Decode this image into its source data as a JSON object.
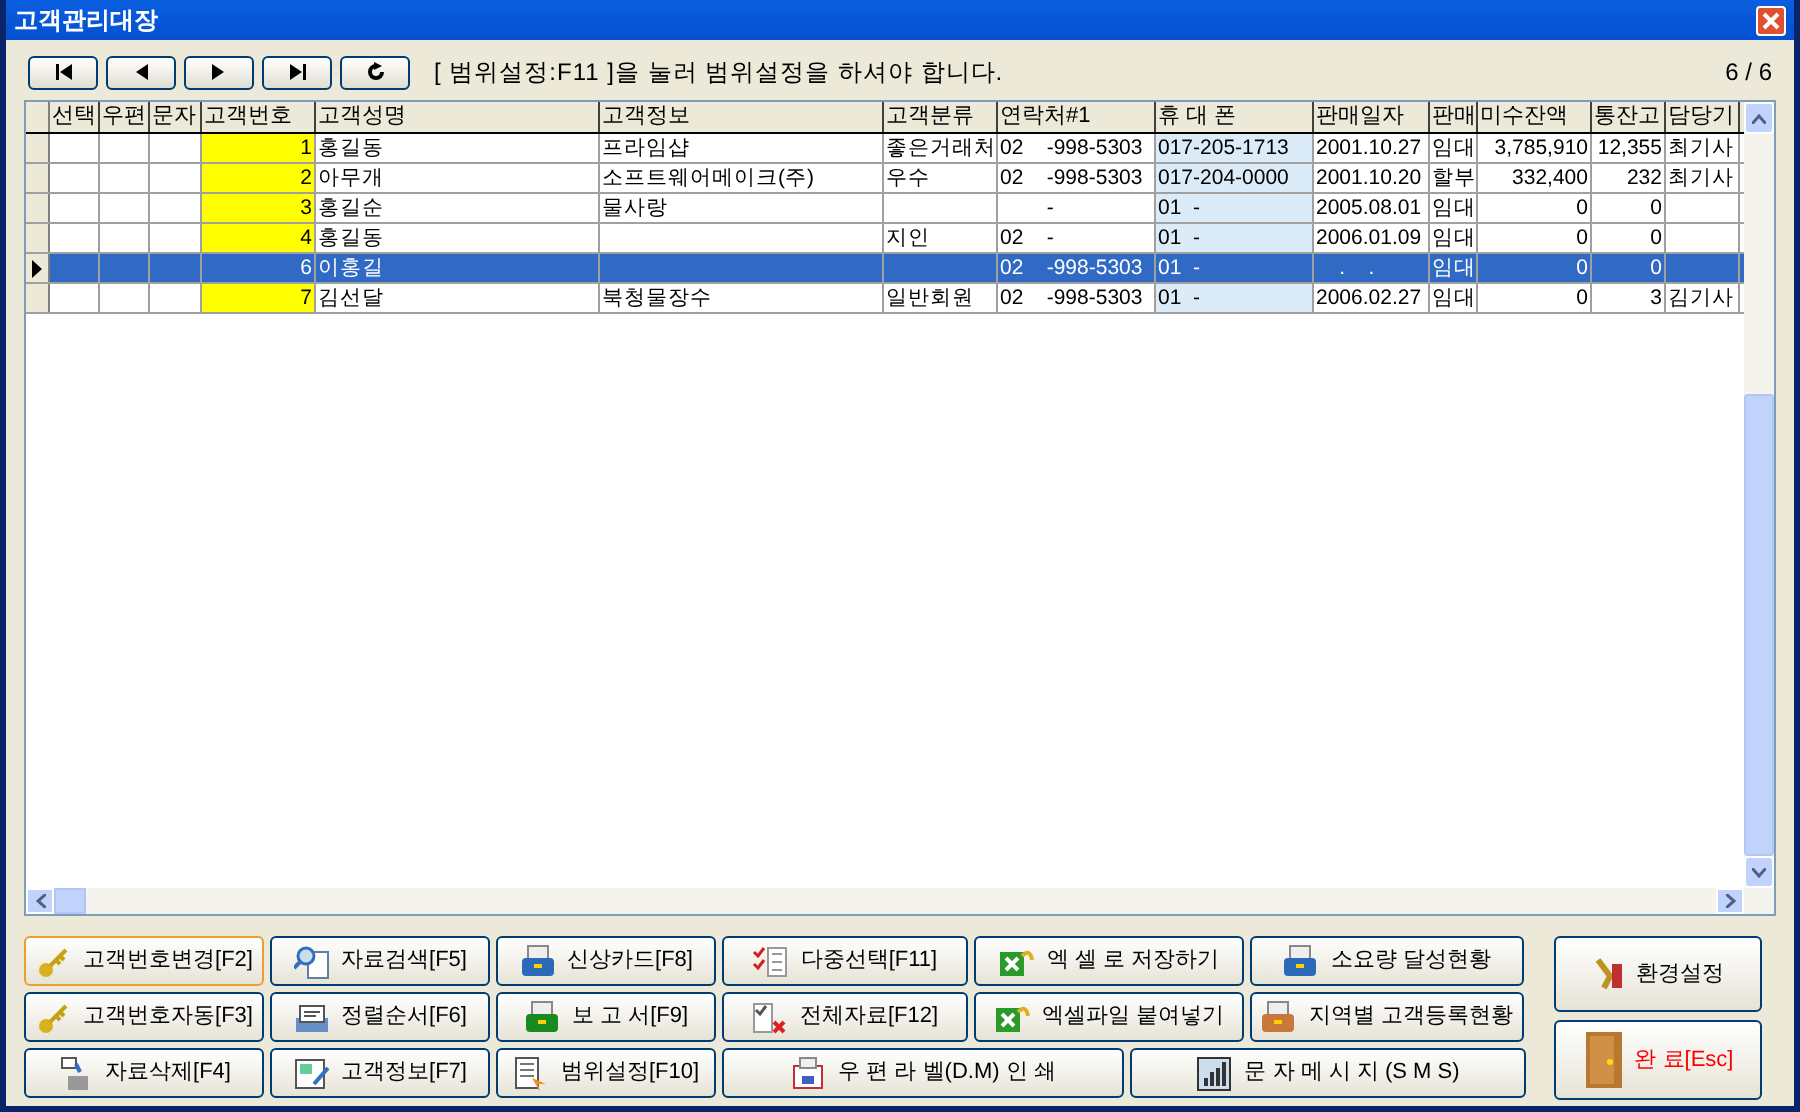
{
  "window": {
    "title": "고객관리대장"
  },
  "toolbar": {
    "message": "[ 범위설정:F11 ]을 눌러 범위설정을 하셔야 합니다.",
    "record_count": "6 / 6"
  },
  "table": {
    "columns": [
      "선택",
      "우편",
      "문자",
      "고객번호",
      "고객성명",
      "고객정보",
      "고객분류",
      "연락처#1",
      "휴 대 폰",
      "판매일자",
      "판매",
      "미수잔액",
      "통잔고",
      "담당기"
    ],
    "rows": [
      {
        "selected": false,
        "cells": [
          "",
          "",
          "",
          "1",
          "홍길동",
          "프라임샵",
          "좋은거래처",
          "02    -998-5303",
          "017-205-1713",
          "2001.10.27",
          "임대",
          "3,785,910",
          "12,355",
          "최기사"
        ]
      },
      {
        "selected": false,
        "cells": [
          "",
          "",
          "",
          "2",
          "아무개",
          "소프트웨어메이크(주)",
          "우수",
          "02    -998-5303",
          "017-204-0000",
          "2001.10.20",
          "할부",
          "332,400",
          "232",
          "최기사"
        ]
      },
      {
        "selected": false,
        "cells": [
          "",
          "",
          "",
          "3",
          "홍길순",
          "물사랑",
          "",
          "        -",
          "01  -",
          "2005.08.01",
          "임대",
          "0",
          "0",
          ""
        ]
      },
      {
        "selected": false,
        "cells": [
          "",
          "",
          "",
          "4",
          "홍길동",
          "",
          "지인",
          "02    -",
          "01  -",
          "2006.01.09",
          "임대",
          "0",
          "0",
          ""
        ]
      },
      {
        "selected": true,
        "cells": [
          "",
          "",
          "",
          "6",
          "이홍길",
          "",
          "",
          "02    -998-5303",
          "01  -",
          "    .    .",
          "임대",
          "0",
          "0",
          ""
        ]
      },
      {
        "selected": false,
        "cells": [
          "",
          "",
          "",
          "7",
          "김선달",
          "북청물장수",
          "일반회원",
          "02    -998-5303",
          "01  -",
          "2006.02.27",
          "임대",
          "0",
          "3",
          "김기사"
        ]
      }
    ]
  },
  "buttons": [
    [
      "고객번호변경[F2]",
      "자료검색[F5]",
      "신상카드[F8]",
      "다중선택[F11]",
      "엑 셀 로 저장하기",
      "소요량 달성현황"
    ],
    [
      "고객번호자동[F3]",
      "정렬순서[F6]",
      "보 고 서[F9]",
      "전체자료[F12]",
      "엑셀파일 붙여넣기",
      "지역별 고객등록현황"
    ],
    [
      "자료삭제[F4]",
      "고객정보[F7]",
      "범위설정[F10]",
      "우 편 라 벨(D.M) 인 쇄",
      "문 자 메 시 지 (S M S)"
    ]
  ],
  "side_buttons": [
    {
      "label": "환경설정",
      "kind": "normal"
    },
    {
      "label": "완 료[Esc]",
      "kind": "exit"
    }
  ]
}
